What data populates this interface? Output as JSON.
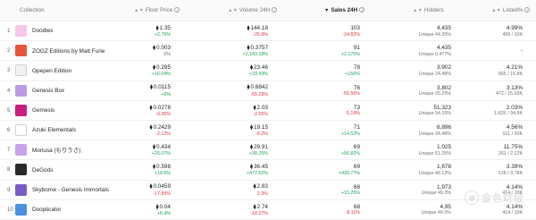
{
  "header": {
    "collection": "Collection",
    "floor_price": "Floor Price",
    "volume_24h": "Volume 24H",
    "sales_24h": "Sales 24H",
    "holders": "Holders",
    "listed": "Listed%",
    "sort_icon": "▲▼",
    "sort_active_icon": "▼",
    "info_icon": "i"
  },
  "eth_symbol": "⧫",
  "rows": [
    {
      "rank": "1",
      "name": "Doodles",
      "thumb_color": "#f7c6e8",
      "floor": "1.35",
      "floor_chg": "+2.75%",
      "floor_dir": "up",
      "vol": "144.18",
      "vol_chg": "-25.9%",
      "vol_dir": "down",
      "sales": "103",
      "sales_chg": "-24.82%",
      "sales_dir": "down",
      "holders": "4,435",
      "holders_sub": "Unique 44.35%",
      "listed": "4.99%",
      "listed_sub": "499 / 10K"
    },
    {
      "rank": "2",
      "name": "ZOGZ Editions by Matt Furie",
      "thumb_color": "#e8553f",
      "floor": "0.003",
      "floor_chg": "0%",
      "floor_dir": "muted",
      "vol": "0.3757",
      "vol_chg": "+2,143.18%",
      "vol_dir": "up",
      "sales": "91",
      "sales_chg": "+2,175%",
      "sales_dir": "up",
      "holders": "4,435",
      "holders_sub": "Unique 0.477%",
      "listed": "-",
      "listed_sub": ""
    },
    {
      "rank": "3",
      "name": "Opepen Edition",
      "thumb_color": "#f1f1f1",
      "floor": "0.295",
      "floor_chg": "+16.04%",
      "floor_dir": "up",
      "vol": "23.46",
      "vol_chg": "+33.43%",
      "vol_dir": "up",
      "sales": "78",
      "sales_chg": "+150%",
      "sales_dir": "up",
      "holders": "3,902",
      "holders_sub": "Unique 24.48%",
      "listed": "4.21%",
      "listed_sub": "665 / 15.8K"
    },
    {
      "rank": "4",
      "name": "Genesis Box",
      "thumb_color": "#b99be6",
      "floor": "0.0115",
      "floor_chg": "+6%",
      "floor_dir": "up",
      "vol": "0.8842",
      "vol_chg": "-55.29%",
      "vol_dir": "down",
      "sales": "76",
      "sales_chg": "-55.56%",
      "sales_dir": "down",
      "holders": "3,802",
      "holders_sub": "Unique 25.29%",
      "listed": "3.13%",
      "listed_sub": "472 / 15.03K"
    },
    {
      "rank": "5",
      "name": "Gemesis",
      "thumb_color": "#c81e7e",
      "floor": "0.0278",
      "floor_chg": "-0.36%",
      "floor_dir": "down",
      "vol": "2.03",
      "vol_chg": "-2.65%",
      "vol_dir": "down",
      "sales": "73",
      "sales_chg": "-5.19%",
      "sales_dir": "down",
      "holders": "51,323",
      "holders_sub": "Unique 54.16%",
      "listed": "2.03%",
      "listed_sub": "1.92K / 94.8K"
    },
    {
      "rank": "6",
      "name": "Azuki Elementals",
      "thumb_color": "#ffffff",
      "floor": "0.2429",
      "floor_chg": "-2.12%",
      "floor_dir": "down",
      "vol": "19.15",
      "vol_chg": "-6.2%",
      "vol_dir": "down",
      "sales": "71",
      "sales_chg": "+14.52%",
      "sales_dir": "up",
      "holders": "6,896",
      "holders_sub": "Unique 34.48%",
      "listed": "4.56%",
      "listed_sub": "911 / 20K"
    },
    {
      "rank": "7",
      "name": "Moriusa (もりうさ)",
      "thumb_color": "#c7a3e8",
      "floor": "0.434",
      "floor_chg": "+25.07%",
      "floor_dir": "up",
      "vol": "29.91",
      "vol_chg": "+38.25%",
      "vol_dir": "up",
      "sales": "69",
      "sales_chg": "+56.82%",
      "sales_dir": "up",
      "holders": "1,025",
      "holders_sub": "Unique 51.25%",
      "listed": "11.75%",
      "listed_sub": "261 / 2.22K"
    },
    {
      "rank": "8",
      "name": "DeGods",
      "thumb_color": "#2a2a2a",
      "floor": "0.598",
      "floor_chg": "+19.6%",
      "floor_dir": "up",
      "vol": "36.45",
      "vol_chg": "+477.52%",
      "vol_dir": "up",
      "sales": "69",
      "sales_chg": "+430.77%",
      "sales_dir": "up",
      "holders": "1,678",
      "holders_sub": "Unique 46.13%",
      "listed": "3.39%",
      "listed_sub": "128 / 3.78K"
    },
    {
      "rank": "9",
      "name": "Skyborne - Genesis Immortals",
      "thumb_color": "#7a5cc7",
      "floor": "0.0459",
      "floor_chg": "-17.89%",
      "floor_dir": "down",
      "vol": "2.83",
      "vol_chg": "2.3%",
      "vol_dir": "down",
      "sales": "68",
      "sales_chg": "+15.25%",
      "sales_dir": "up",
      "holders": "1,973",
      "holders_sub": "Unique 49.3%",
      "listed": "4.14%",
      "listed_sub": "414 / 10K"
    },
    {
      "rank": "10",
      "name": "Dooplicator",
      "thumb_color": "#4a8fe0",
      "floor": "0.04",
      "floor_chg": "+8.4%",
      "floor_dir": "up",
      "vol": "2.74",
      "vol_chg": "-18.27%",
      "vol_dir": "down",
      "sales": "68",
      "sales_chg": "-8.11%",
      "sales_dir": "down",
      "holders": "4,95",
      "holders_sub": "Unique 49.5%",
      "listed": "4.14%",
      "listed_sub": "414 / 10K"
    }
  ],
  "watermark": {
    "text": "金色财经"
  }
}
